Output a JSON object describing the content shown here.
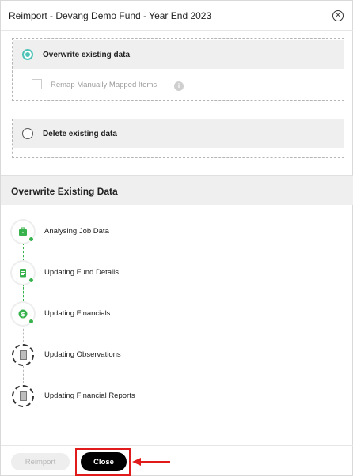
{
  "dialog": {
    "title": "Reimport - Devang Demo Fund - Year End 2023",
    "close_icon": "circle-x-icon"
  },
  "options": {
    "overwrite": {
      "label": "Overwrite existing data",
      "selected": true
    },
    "remap": {
      "label": "Remap Manually Mapped Items",
      "checked": false,
      "disabled": true,
      "info_icon": "info-icon"
    },
    "delete": {
      "label": "Delete existing data",
      "selected": false
    }
  },
  "progress": {
    "title": "Overwrite Existing Data",
    "steps": [
      {
        "label": "Analysing Job Data",
        "icon": "briefcase-icon",
        "status": "done"
      },
      {
        "label": "Updating Fund Details",
        "icon": "clipboard-icon",
        "status": "done"
      },
      {
        "label": "Updating Financials",
        "icon": "dollar-coin-icon",
        "status": "done"
      },
      {
        "label": "Updating Observations",
        "icon": "document-refresh-icon",
        "status": "pending"
      },
      {
        "label": "Updating Financial Reports",
        "icon": "document-refresh-icon",
        "status": "pending"
      }
    ]
  },
  "footer": {
    "reimport_label": "Reimport",
    "close_label": "Close"
  },
  "colors": {
    "accent": "#4ec3b7",
    "done": "#37b24d",
    "highlight": "#e11b1b"
  }
}
